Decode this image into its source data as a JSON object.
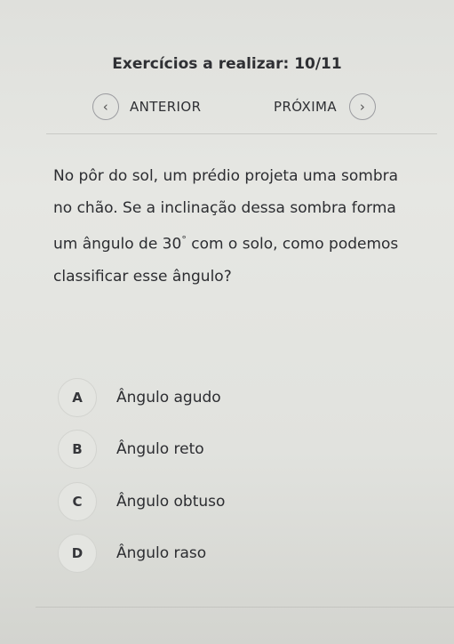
{
  "header": {
    "title": "Exercícios a realizar: 10/11"
  },
  "nav": {
    "prev_label": "ANTERIOR",
    "next_label": "PRÓXIMA",
    "prev_icon": "chevron-left-icon",
    "next_icon": "chevron-right-icon"
  },
  "question": {
    "text_before": "No pôr do sol, um prédio projeta uma sombra no chão. Se a inclinação dessa sombra forma um ângulo de 30",
    "degree": "°",
    "text_after": " com o solo, como podemos classificar esse ângulo?"
  },
  "options": [
    {
      "letter": "A",
      "text": "Ângulo agudo"
    },
    {
      "letter": "B",
      "text": "Ângulo reto"
    },
    {
      "letter": "C",
      "text": "Ângulo obtuso"
    },
    {
      "letter": "D",
      "text": "Ângulo raso"
    }
  ]
}
